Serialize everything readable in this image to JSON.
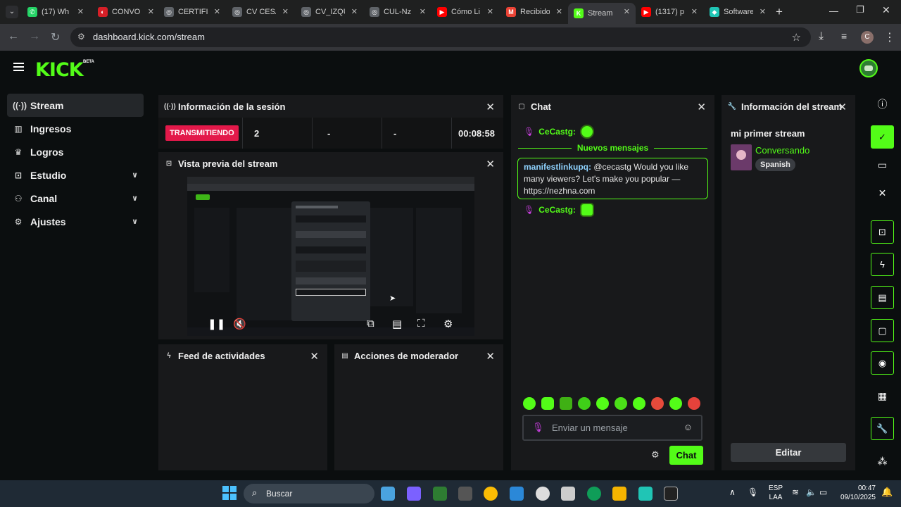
{
  "browser": {
    "tabs": [
      {
        "title": "(17) Wh",
        "color": "#25d366",
        "glyph": "✆"
      },
      {
        "title": "CONVO",
        "color": "#d61f27",
        "glyph": "◐"
      },
      {
        "title": "CERTIFIC",
        "color": "#5f6368",
        "glyph": "◎"
      },
      {
        "title": "CV CESA",
        "color": "#5f6368",
        "glyph": "◎"
      },
      {
        "title": "CV_IZQU",
        "color": "#5f6368",
        "glyph": "◎"
      },
      {
        "title": "CUL-Nz",
        "color": "#5f6368",
        "glyph": "◎"
      },
      {
        "title": "Cómo Li",
        "color": "#ff0000",
        "glyph": "▶"
      },
      {
        "title": "Recibido",
        "color": "#ea4335",
        "glyph": "M"
      },
      {
        "title": "Stream",
        "color": "#53fc18",
        "glyph": "K"
      },
      {
        "title": "(1317) p",
        "color": "#ff0000",
        "glyph": "▶"
      },
      {
        "title": "Software",
        "color": "#20c5b5",
        "glyph": "◆"
      }
    ],
    "url": "dashboard.kick.com/stream",
    "profile_initial": "C"
  },
  "app": {
    "logo": "KICK",
    "beta": "BETA"
  },
  "sidebar": {
    "items": [
      {
        "label": "Stream",
        "icon": "broadcast-icon"
      },
      {
        "label": "Ingresos",
        "icon": "chart-icon"
      },
      {
        "label": "Logros",
        "icon": "trophy-icon"
      },
      {
        "label": "Estudio",
        "icon": "studio-icon"
      },
      {
        "label": "Canal",
        "icon": "channel-icon"
      },
      {
        "label": "Ajustes",
        "icon": "gear-icon"
      }
    ]
  },
  "session": {
    "title": "Información de la sesión",
    "status": "TRANSMITIENDO",
    "viewers": "2",
    "stat2": "-",
    "stat3": "-",
    "duration": "00:08:58"
  },
  "preview": {
    "title": "Vista previa del stream"
  },
  "feed": {
    "title": "Feed de actividades"
  },
  "mod": {
    "title": "Acciones de moderador"
  },
  "chat": {
    "title": "Chat",
    "user1": "CeCastg:",
    "new_messages": "Nuevos mensajes",
    "msg_user": "manifestlinkupq:",
    "msg_text": "@cecastg Would you like many viewers? Let's make you popular — https://nezhna.com",
    "user2": "CeCastg:",
    "input_placeholder": "Enviar un mensaje",
    "send_label": "Chat"
  },
  "stream_info": {
    "title": "Información del stream",
    "stream_title": "mi primer stream",
    "category": "Conversando",
    "language": "Spanish",
    "edit_label": "Editar"
  },
  "taskbar": {
    "search_placeholder": "Buscar",
    "lang_top": "ESP",
    "lang_bottom": "LAA",
    "time": "00:47",
    "date": "09/10/2025"
  },
  "colors": {
    "accent": "#53fc18",
    "live": "#e3194a",
    "panel": "#18191b"
  }
}
